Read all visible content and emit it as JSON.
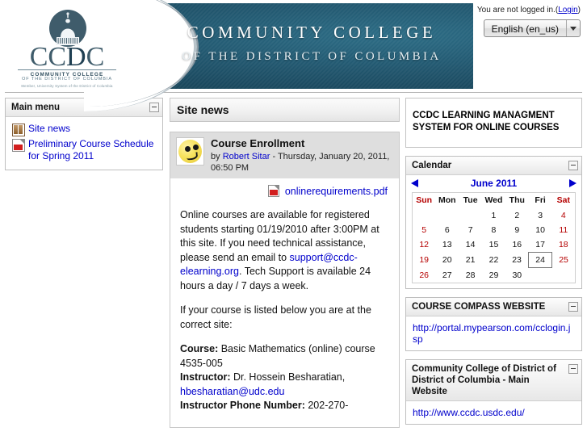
{
  "header": {
    "login_notice": "You are not logged in.",
    "login_paren_open": "(",
    "login_link": "Login",
    "login_paren_close": ")",
    "language_selected": "English (en_us)",
    "banner_title": "COMMUNITY  COLLEGE",
    "banner_subtitle": "OF THE DISTRICT OF COLUMBIA",
    "logo": {
      "acronym_cc": "CC",
      "acronym_d": "D",
      "acronym_c2": "C",
      "line1": "COMMUNITY COLLEGE",
      "line2": "OF THE DISTRICT OF COLUMBIA",
      "line3": "Member, University System of the District of Columbia"
    }
  },
  "left_block": {
    "title": "Main menu",
    "items": [
      {
        "label": "Site news",
        "icon": "forum-icon"
      },
      {
        "label": "Preliminary Course Schedule for Spring 2011",
        "icon": "pdf-icon"
      }
    ]
  },
  "main": {
    "section_title": "Site news",
    "post": {
      "subject": "Course Enrollment",
      "by_prefix": "by ",
      "author": "Robert Sitar",
      "date": " - Thursday, January 20, 2011, 06:50 PM",
      "attachment": "onlinerequirements.pdf",
      "paragraph1_a": "Online courses are available for registered students starting 01/19/2010 after 3:00PM at this site.  If you need technical assistance, please send an email to ",
      "paragraph1_email": "support@ccdc-elearning.org",
      "paragraph1_b": ". Tech Support is available 24 hours a day / 7 days a week.",
      "paragraph2": "If your course is listed below you are at the correct site:",
      "course_label": "Course:",
      "course_value": " Basic Mathematics (online) course 4535-005",
      "instructor_label": "Instructor:",
      "instructor_value": " Dr. Hossein Besharatian,",
      "instructor_email": "hbesharatian@udc.edu",
      "phone_label": "Instructor Phone Number:",
      "phone_value": " 202-270-"
    }
  },
  "right": {
    "lms_line1": "CCDC LEARNING MANAGMENT",
    "lms_line2": "SYSTEM FOR ONLINE COURSES",
    "calendar": {
      "title": "Calendar",
      "month_label": "June 2011",
      "prev_label": "Previous month",
      "next_label": "Next month",
      "weekdays": [
        "Sun",
        "Mon",
        "Tue",
        "Wed",
        "Thu",
        "Fri",
        "Sat"
      ],
      "weeks": [
        [
          "",
          "",
          "",
          "1",
          "2",
          "3",
          "4"
        ],
        [
          "5",
          "6",
          "7",
          "8",
          "9",
          "10",
          "11"
        ],
        [
          "12",
          "13",
          "14",
          "15",
          "16",
          "17",
          "18"
        ],
        [
          "19",
          "20",
          "21",
          "22",
          "23",
          "24",
          "25"
        ],
        [
          "26",
          "27",
          "28",
          "29",
          "30",
          "",
          ""
        ]
      ],
      "today": "24",
      "weekend_columns": [
        0,
        6
      ]
    },
    "course_compass": {
      "title": "COURSE COMPASS WEBSITE",
      "link": "http://portal.mypearson.com/cclogin.jsp"
    },
    "main_website": {
      "title": "Community College of District of District of Columbia - Main Website",
      "link": "http://www.ccdc.usdc.edu/"
    }
  },
  "colors": {
    "banner": "#235a72",
    "link": "#0000cc",
    "weekend": "#b50000",
    "block_border": "#bfbfbf"
  }
}
